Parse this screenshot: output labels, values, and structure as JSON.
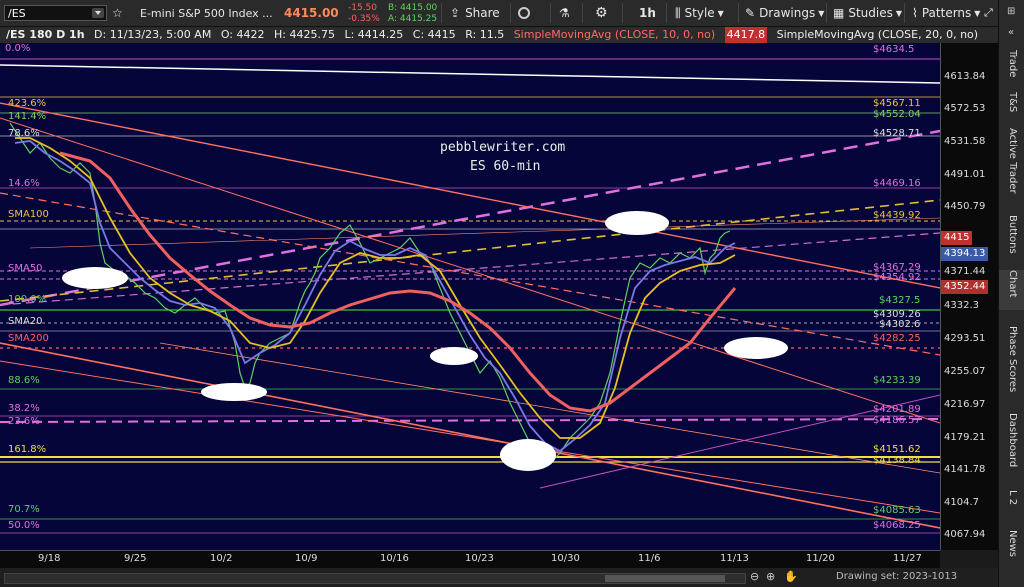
{
  "toolbar": {
    "symbol": "/ES",
    "instrument": "E-mini S&P 500 Index ...",
    "last": "4415.00",
    "change": "-15.50",
    "change_pct": "-0.35%",
    "bid": "B: 4415.00",
    "ask": "A: 4415.25",
    "share": "Share",
    "interval": "1h",
    "style": "Style",
    "drawings": "Drawings",
    "studies": "Studies",
    "patterns": "Patterns"
  },
  "infobar": {
    "desc": "/ES 180 D 1h",
    "date": "D: 11/13/23, 5:00 AM",
    "open": "O: 4422",
    "high": "H: 4425.75",
    "low": "L: 4414.25",
    "close": "C: 4415",
    "range": "R: 11.5",
    "sma10": "SimpleMovingAvg (CLOSE, 10, 0, no)",
    "sma10_val": "4417.8",
    "sma20": "SimpleMovingAvg (CLOSE, 20, 0, no)"
  },
  "watermark": {
    "line1": "pebblewriter.com",
    "line2": "ES 60-min"
  },
  "yaxis": [
    "4613.84",
    "4572.53",
    "4531.58",
    "4491.01",
    "4450.79",
    "4371.44",
    "4332.3",
    "4293.51",
    "4255.07",
    "4216.97",
    "4179.21",
    "4141.78",
    "4104.7",
    "4067.94"
  ],
  "price_tags": [
    {
      "text": "4415",
      "color": "#c03030"
    },
    {
      "text": "4394.13",
      "color": "#3a5aa8"
    },
    {
      "text": "4352.44",
      "color": "#b03030"
    }
  ],
  "xaxis": [
    "9/18",
    "9/25",
    "10/2",
    "10/9",
    "10/16",
    "10/23",
    "10/30",
    "11/6",
    "11/13",
    "11/20",
    "11/27"
  ],
  "levels_right": [
    {
      "text": "$4634.5",
      "color": "#e070e0"
    },
    {
      "text": "$4567.11",
      "color": "#f0c040"
    },
    {
      "text": "$4552.04",
      "color": "#80d060"
    },
    {
      "text": "$4528.71",
      "color": "#dddddd"
    },
    {
      "text": "$4469.16",
      "color": "#e070e0"
    },
    {
      "text": "$4439.92",
      "color": "#f0c040"
    },
    {
      "text": "$4367.29",
      "color": "#e070e0"
    },
    {
      "text": "$4354.92",
      "color": "#e070e0"
    },
    {
      "text": "$4327.5",
      "color": "#60d060"
    },
    {
      "text": "$4309.26",
      "color": "#dddddd"
    },
    {
      "text": "$4302.6",
      "color": "#dddddd"
    },
    {
      "text": "$4282.25",
      "color": "#ff6060"
    },
    {
      "text": "$4233.39",
      "color": "#60d060"
    },
    {
      "text": "$4201.89",
      "color": "#e070e0"
    },
    {
      "text": "$4186.57",
      "color": "#e070e0"
    },
    {
      "text": "$4151.62",
      "color": "#f0e040"
    },
    {
      "text": "$4138.84",
      "color": "#f0e040"
    },
    {
      "text": "$4085.63",
      "color": "#60d060"
    },
    {
      "text": "$4068.25",
      "color": "#e070e0"
    }
  ],
  "levels_left": [
    {
      "text": "0.0%",
      "color": "#e070e0"
    },
    {
      "text": "423.6%",
      "color": "#f0c040"
    },
    {
      "text": "141.4%",
      "color": "#80d060"
    },
    {
      "text": "78.6%",
      "color": "#dddddd"
    },
    {
      "text": "14.6%",
      "color": "#e070e0"
    },
    {
      "text": "SMA100",
      "color": "#f0c040"
    },
    {
      "text": "SMA50",
      "color": "#e070e0"
    },
    {
      "text": "100.0%",
      "color": "#60d060"
    },
    {
      "text": "SMA20",
      "color": "#dddddd"
    },
    {
      "text": "SMA200",
      "color": "#ff6060"
    },
    {
      "text": "88.6%",
      "color": "#60d060"
    },
    {
      "text": "38.2%",
      "color": "#e070e0"
    },
    {
      "text": "23.6%",
      "color": "#e070e0"
    },
    {
      "text": "161.8%",
      "color": "#f0e040"
    },
    {
      "text": "70.7%",
      "color": "#60d060"
    },
    {
      "text": "50.0%",
      "color": "#e070e0"
    }
  ],
  "sidetabs": [
    "Trade",
    "T&S",
    "Active Trader",
    "Buttons",
    "Chart",
    "Phase Scores",
    "Dashboard",
    "L 2",
    "News"
  ],
  "bottom": {
    "drawing_set": "Drawing set: 2023-1013"
  }
}
